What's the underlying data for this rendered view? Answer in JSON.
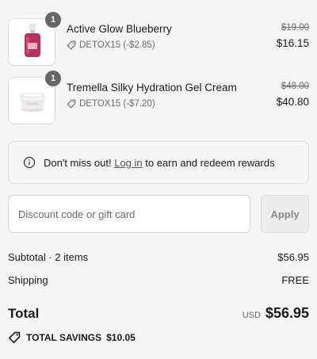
{
  "line_items": [
    {
      "quantity": "1",
      "title": "Active Glow Blueberry",
      "discount": "DETOX15 (-$2.85)",
      "original_price": "$19.00",
      "final_price": "$16.15",
      "thumbnail": "serum-bottle-image"
    },
    {
      "quantity": "1",
      "title": "Tremella Silky Hydration Gel Cream",
      "discount": "DETOX15 (-$7.20)",
      "original_price": "$48.00",
      "final_price": "$40.80",
      "thumbnail": "cream-jar-image"
    }
  ],
  "rewards": {
    "prefix": "Don't miss out!",
    "link": "Log in",
    "suffix": "to earn and redeem rewards"
  },
  "discount_field": {
    "placeholder": "Discount code or gift card",
    "value": "",
    "apply_label": "Apply"
  },
  "summary": {
    "subtotal_label": "Subtotal · 2 items",
    "subtotal_value": "$56.95",
    "shipping_label": "Shipping",
    "shipping_value": "FREE",
    "total_label": "Total",
    "currency": "USD",
    "total_value": "$56.95",
    "savings_label": "TOTAL SAVINGS",
    "savings_value": "$10.05"
  },
  "colors": {
    "background": "#f5f5f5",
    "badge": "#666666",
    "muted_text": "#6b6b6b",
    "bottle_liquid": "#c23a63"
  },
  "icons": [
    "tag-icon",
    "info-icon",
    "savings-tag-icon"
  ]
}
